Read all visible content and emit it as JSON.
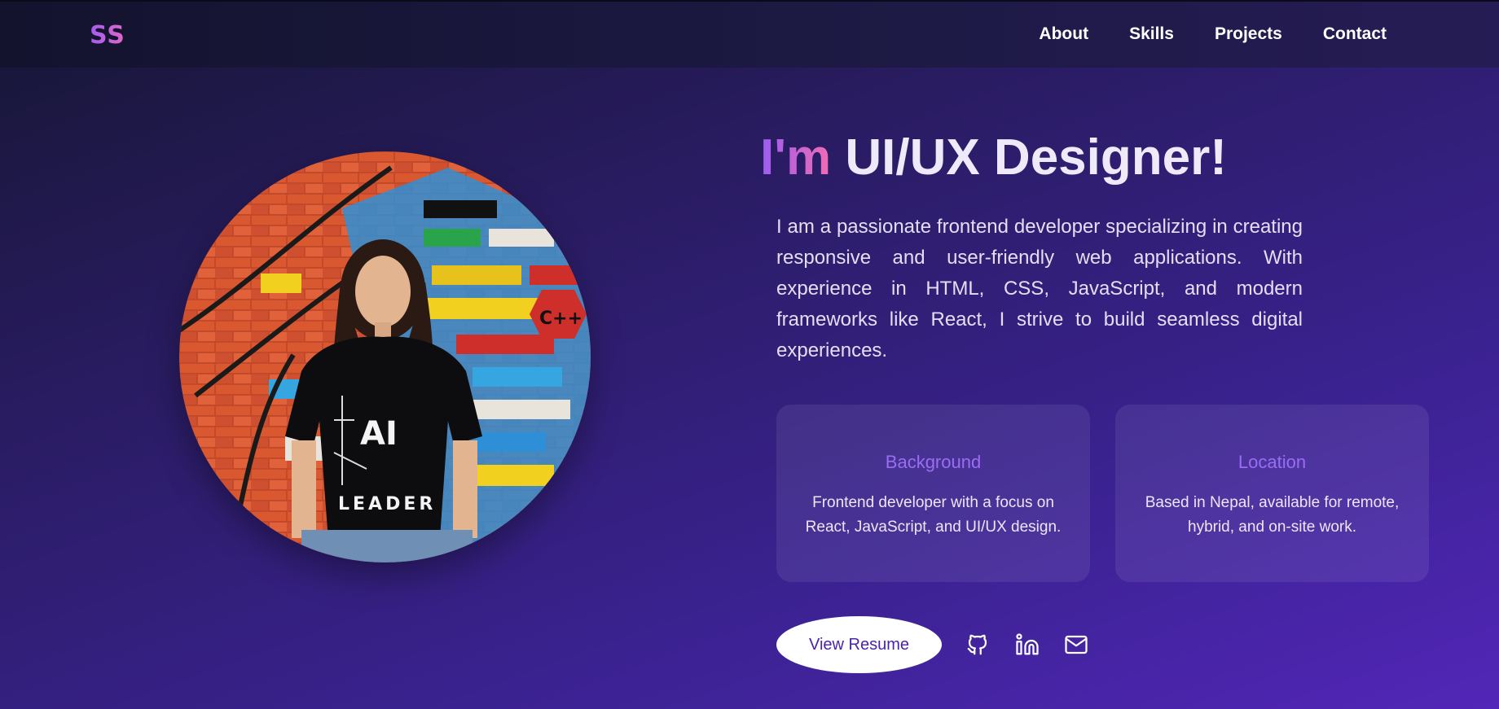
{
  "brand": {
    "logo_text": "SS"
  },
  "nav": {
    "items": [
      {
        "label": "About"
      },
      {
        "label": "Skills"
      },
      {
        "label": "Projects"
      },
      {
        "label": "Contact"
      }
    ]
  },
  "hero": {
    "headline_prefix": "I'm",
    "headline_role": "UI/UX Designer!",
    "intro": "I am a passionate frontend developer specializing in creating responsive and user-friendly web applications. With experience in HTML, CSS, JavaScript, and modern frameworks like React, I strive to build seamless digital experiences.",
    "portrait_tshirt_text": "AI",
    "portrait_tshirt_subtext": "LEADER"
  },
  "cards": [
    {
      "title": "Background",
      "text": "Frontend developer with a focus on React, JavaScript, and UI/UX design."
    },
    {
      "title": "Location",
      "text": "Based in Nepal, available for remote, hybrid, and on-site work."
    }
  ],
  "actions": {
    "resume_label": "View Resume",
    "social_icons": [
      "github-icon",
      "linkedin-icon",
      "mail-icon"
    ]
  },
  "colors": {
    "accent_purple": "#9c6cf5",
    "accent_pink": "#f06cb4",
    "button_text": "#4a22b0"
  }
}
